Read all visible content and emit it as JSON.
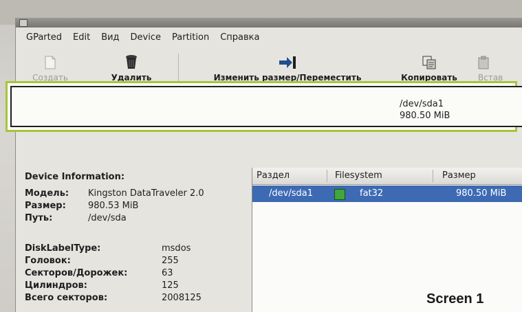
{
  "menubar": {
    "items": [
      "GParted",
      "Edit",
      "Вид",
      "Device",
      "Partition",
      "Справка"
    ]
  },
  "toolbar": {
    "create_label": "Создать",
    "delete_label": "Удалить",
    "resize_label": "Изменить размер/Переместить",
    "copy_label": "Копировать",
    "paste_label": "Встав"
  },
  "partition_map": {
    "device": "/dev/sda1",
    "size": "980.50 MiB"
  },
  "device_info": {
    "heading": "Device Information:",
    "model_key": "Модель:",
    "model_value": "Kingston DataTraveler 2.0",
    "size_key": "Размер:",
    "size_value": "980.53 MiB",
    "path_key": "Путь:",
    "path_value": "/dev/sda",
    "disklabel_key": "DiskLabelType:",
    "disklabel_value": "msdos",
    "heads_key": "Головок:",
    "heads_value": "255",
    "sectors_track_key": "Секторов/Дорожек:",
    "sectors_track_value": "63",
    "cylinders_key": "Цилиндров:",
    "cylinders_value": "125",
    "total_sectors_key": "Всего секторов:",
    "total_sectors_value": "2008125"
  },
  "table": {
    "col_partition": "Раздел",
    "col_filesystem": "Filesystem",
    "col_size": "Размер",
    "row_partition": "/dev/sda1",
    "row_filesystem": "fat32",
    "row_size": "980.50 MiB"
  },
  "caption": "Screen 1",
  "colors": {
    "selection": "#3d6ab3",
    "partition_border": "#a6c637",
    "fat32": "#3ea83a"
  }
}
